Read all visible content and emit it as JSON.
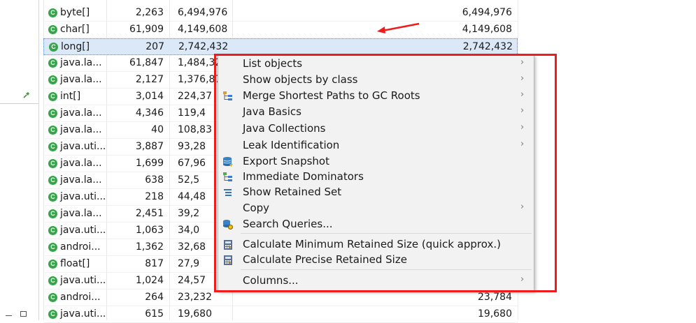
{
  "table": {
    "rows": [
      {
        "name": "byte[]",
        "objects": "2,263",
        "shallow": "6,494,976",
        "retained": "6,494,976"
      },
      {
        "name": "char[]",
        "objects": "61,909",
        "shallow": "4,149,608",
        "retained": "4,149,608"
      },
      {
        "name": "long[]",
        "objects": "207",
        "shallow": "2,742,432",
        "retained": "2,742,432",
        "selected": true
      },
      {
        "name": "java.la...",
        "objects": "61,847",
        "shallow": "1,484,32",
        "retained": ""
      },
      {
        "name": "java.la...",
        "objects": "2,127",
        "shallow": "1,376,87",
        "retained": ""
      },
      {
        "name": "int[]",
        "objects": "3,014",
        "shallow": "224,37",
        "retained": ""
      },
      {
        "name": "java.la...",
        "objects": "4,346",
        "shallow": "119,4",
        "retained": ""
      },
      {
        "name": "java.la...",
        "objects": "40",
        "shallow": "108,83",
        "retained": ""
      },
      {
        "name": "java.uti...",
        "objects": "3,887",
        "shallow": "93,28",
        "retained": ""
      },
      {
        "name": "java.la...",
        "objects": "1,699",
        "shallow": "67,96",
        "retained": ""
      },
      {
        "name": "java.la...",
        "objects": "638",
        "shallow": "52,5",
        "retained": ""
      },
      {
        "name": "java.uti...",
        "objects": "218",
        "shallow": "44,48",
        "retained": ""
      },
      {
        "name": "java.la...",
        "objects": "2,451",
        "shallow": "39,2",
        "retained": ""
      },
      {
        "name": "java.uti...",
        "objects": "1,063",
        "shallow": "34,0",
        "retained": ""
      },
      {
        "name": "androi...",
        "objects": "1,362",
        "shallow": "32,68",
        "retained": ""
      },
      {
        "name": "float[]",
        "objects": "817",
        "shallow": "27,9",
        "retained": ""
      },
      {
        "name": "java.uti...",
        "objects": "1,024",
        "shallow": "24,57",
        "retained": ""
      },
      {
        "name": "androi...",
        "objects": "264",
        "shallow": "23,232",
        "retained": "23,784"
      },
      {
        "name": "java.uti...",
        "objects": "615",
        "shallow": "19,680",
        "retained": "19,680"
      }
    ],
    "class_icon_letter": "C"
  },
  "context_menu": {
    "items": [
      {
        "label": "List objects",
        "submenu": true,
        "icon": ""
      },
      {
        "label": "Show objects by class",
        "submenu": true,
        "icon": ""
      },
      {
        "label": "Merge Shortest Paths to GC Roots",
        "submenu": true,
        "icon": "tree-paths-icon"
      },
      {
        "label": "Java Basics",
        "submenu": true,
        "icon": ""
      },
      {
        "label": "Java Collections",
        "submenu": true,
        "icon": ""
      },
      {
        "label": "Leak Identification",
        "submenu": true,
        "icon": ""
      },
      {
        "label": "Export Snapshot",
        "submenu": false,
        "icon": "database-export-icon"
      },
      {
        "label": "Immediate Dominators",
        "submenu": false,
        "icon": "dominator-tree-icon"
      },
      {
        "label": "Show Retained Set",
        "submenu": false,
        "icon": "list-lines-icon"
      },
      {
        "label": "Copy",
        "submenu": true,
        "icon": ""
      },
      {
        "label": "Search Queries...",
        "submenu": false,
        "icon": "query-search-icon"
      },
      {
        "label": "Calculate Minimum Retained Size (quick approx.)",
        "submenu": false,
        "icon": "calculator-icon"
      },
      {
        "label": "Calculate Precise Retained Size",
        "submenu": false,
        "icon": "calculator-icon"
      },
      {
        "label": "Columns...",
        "submenu": true,
        "icon": ""
      }
    ],
    "chevron": "›"
  },
  "annotations": {
    "highlight_color": "#ee1c1c",
    "arrow_color": "#ee1c1c"
  }
}
